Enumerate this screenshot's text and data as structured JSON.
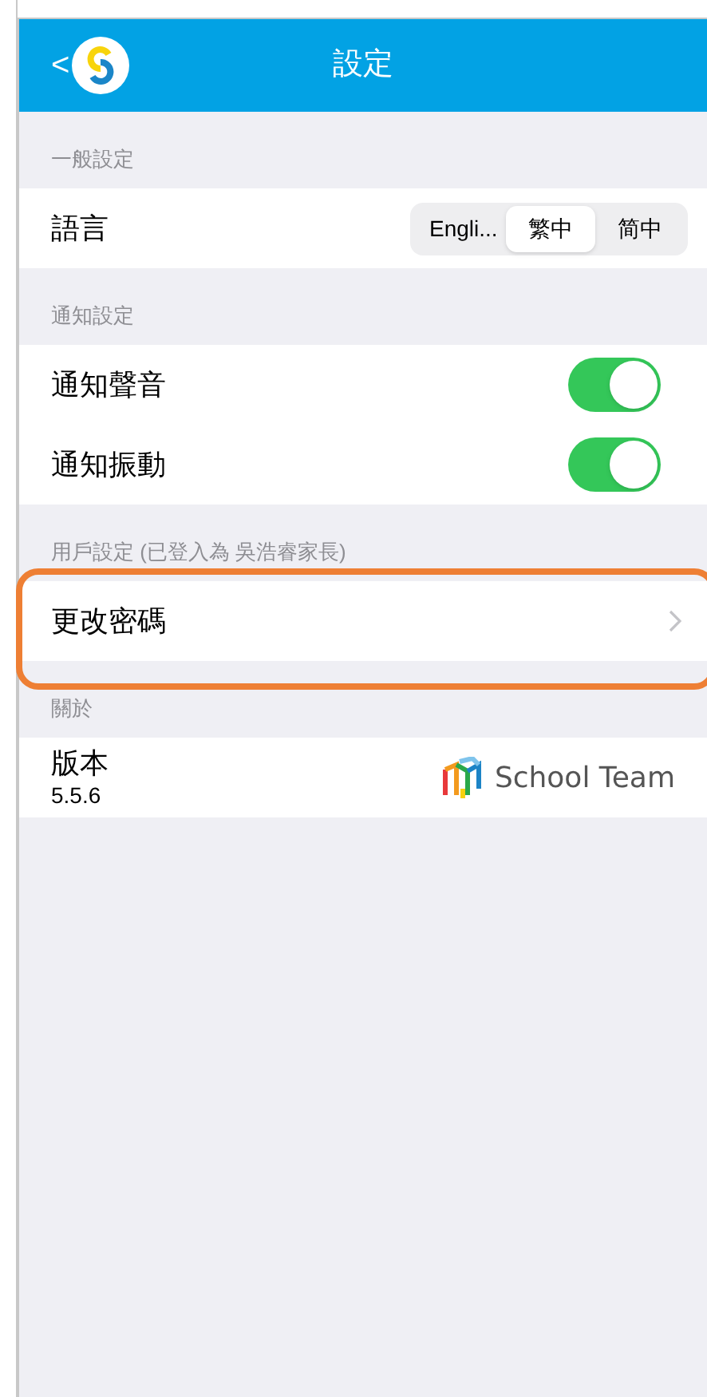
{
  "nav_bar": {
    "back": "<",
    "title": "設定"
  },
  "sections": [
    {
      "header": "一般設定",
      "rows": [
        {
          "kind": "segmented",
          "label": "語言",
          "options": [
            {
              "label": "Engli...",
              "selected": false
            },
            {
              "label": "繁中",
              "selected": true
            },
            {
              "label": "简中",
              "selected": false
            }
          ]
        }
      ]
    },
    {
      "header": "通知設定",
      "rows": [
        {
          "kind": "toggle",
          "label": "通知聲音",
          "on": true
        },
        {
          "kind": "toggle",
          "label": "通知振動",
          "on": true
        }
      ]
    },
    {
      "header": "用戶設定 (已登入為 吳浩睿家長)",
      "rows": [
        {
          "kind": "link",
          "label": "更改密碼",
          "highlighted": true
        }
      ]
    },
    {
      "header": "關於",
      "rows": [
        {
          "kind": "version",
          "label": "版本",
          "value": "5.5.6",
          "brand": "School Team"
        }
      ]
    }
  ]
}
